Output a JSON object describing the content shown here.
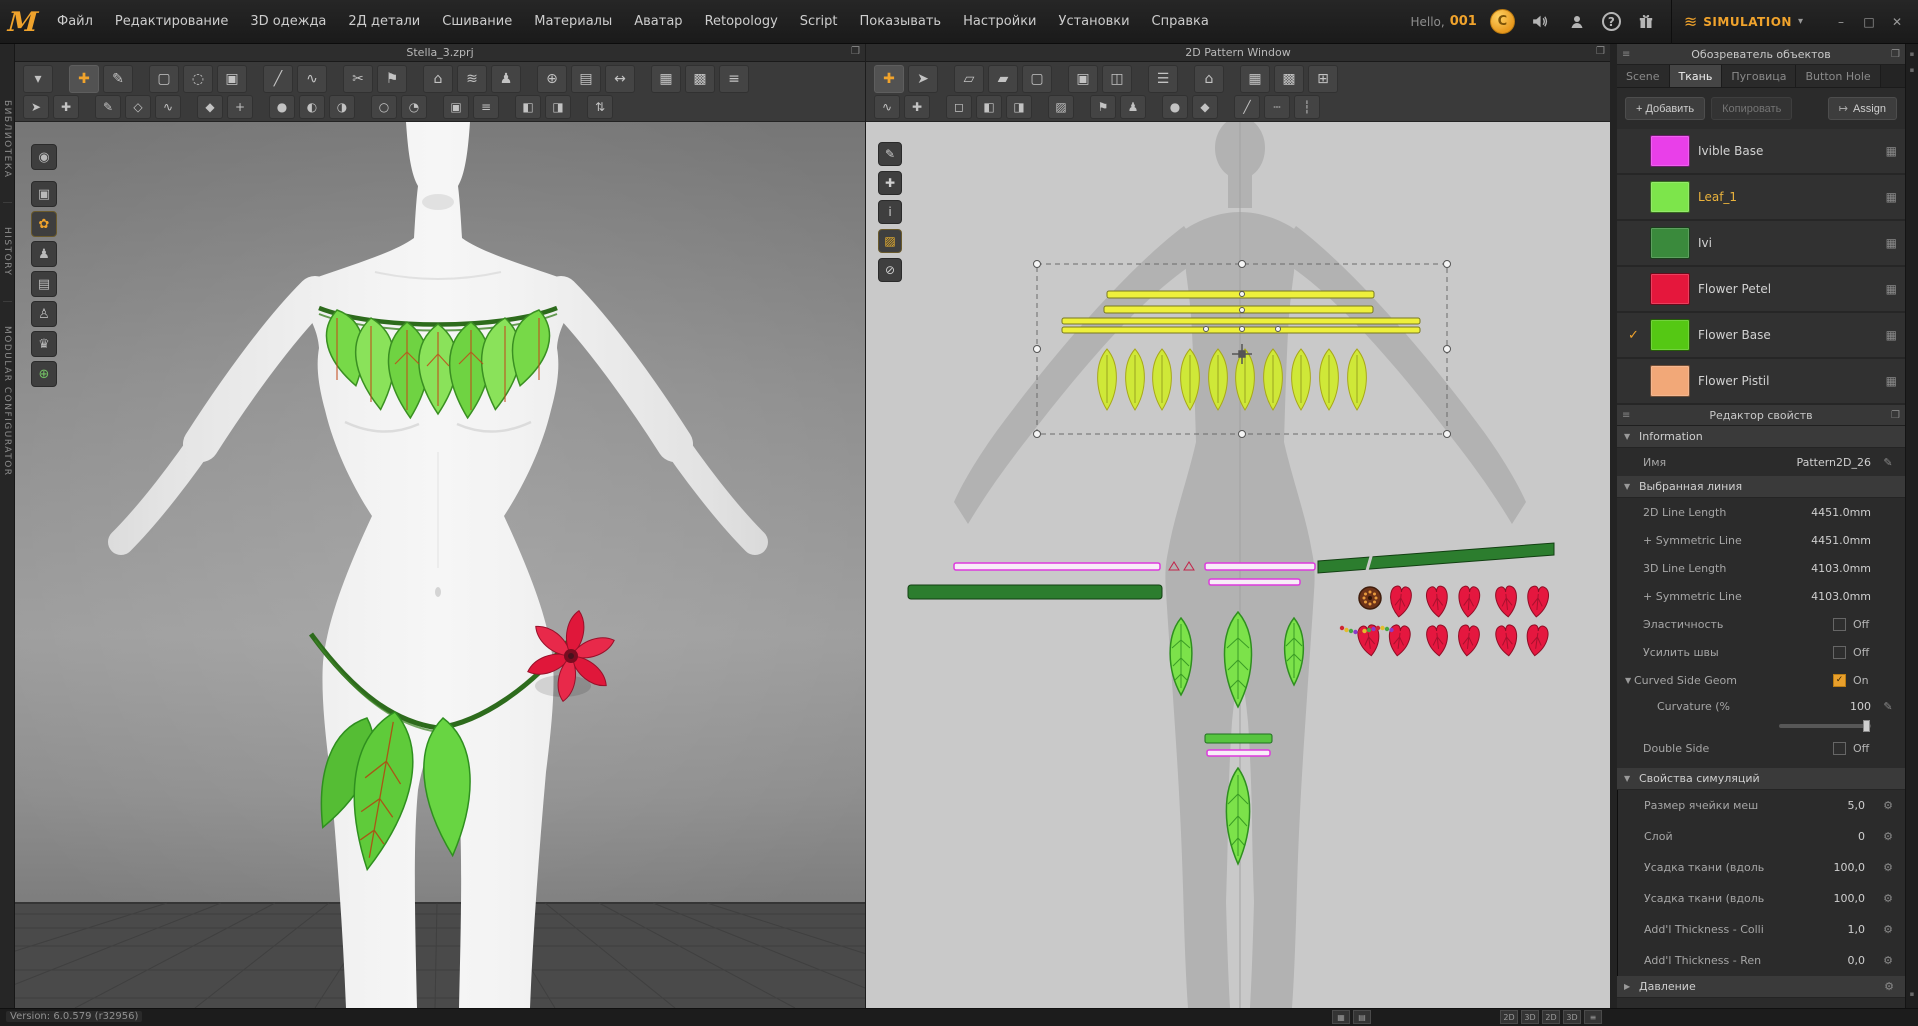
{
  "colors": {
    "accent": "#f0a32c",
    "leaf_green": "#7ce24a",
    "dark_vine_green": "#2d6b1c",
    "petal_red": "#e5173c",
    "magenta": "#e93fe9",
    "pistil_peach": "#f2a878",
    "selection_yellow": "#eef03c"
  },
  "menubar": {
    "logo": "M",
    "items": [
      "Файл",
      "Редактирование",
      "3D одежда",
      "2Д детали",
      "Сшивание",
      "Материалы",
      "Аватар",
      "Retopology",
      "Script",
      "Показывать",
      "Настройки",
      "Установки",
      "Справка"
    ],
    "greeting": "Hello,",
    "user": "001",
    "coin": "C",
    "help": "?",
    "simulation_icon": "≋",
    "simulation": "SIMULATION",
    "caret": "▾",
    "win_min": "–",
    "win_max": "□",
    "win_close": "✕"
  },
  "panels": {
    "p3d_tab": "Stella_3.zprj",
    "p2d_tab": "2D Pattern Window",
    "popup_icon": "❐",
    "side_tabs": [
      "БИБЛИОТЕКА",
      "HISTORY",
      "MODULAR CONFIGURATOR"
    ]
  },
  "toolbars": {
    "t3r1": [
      "▾",
      "✚",
      "✎",
      "▢",
      "◌",
      "▣",
      "╱",
      "∿",
      "✂",
      "⚑",
      "⌂",
      "≋",
      "♟",
      "⊕",
      "▤",
      "↔",
      "▦",
      "▩",
      "≡"
    ],
    "t3r2": [
      "➤",
      "✚",
      "✎",
      "◇",
      "∿",
      "◆",
      "+",
      "●",
      "◐",
      "◑",
      "○",
      "◔",
      "▣",
      "≡",
      "◧",
      "◨",
      "⇅"
    ],
    "t2r1": [
      "✚",
      "➤",
      "▱",
      "▰",
      "▢",
      "▣",
      "◫",
      "☰",
      "⌂",
      "▦",
      "▩",
      "⊞"
    ],
    "t2r2": [
      "∿",
      "✚",
      "◻",
      "◧",
      "◨",
      "▨",
      "⚑",
      "♟",
      "●",
      "◆",
      "╱",
      "┄",
      "┆"
    ],
    "lib": [
      "◉",
      "▣",
      "✿",
      "♟",
      "▤",
      "♙",
      "♛",
      "⊕"
    ],
    "strip2d": [
      "✎",
      "✚",
      "i",
      "▨",
      "⊘"
    ],
    "edge": [
      "▪",
      "▪",
      "▪"
    ]
  },
  "object_browser": {
    "title": "Обозреватель объектов",
    "menu_icon": "≡",
    "popup_icon": "❐",
    "tabs": [
      "Scene",
      "Ткань",
      "Пуговица",
      "Button Hole"
    ],
    "add_label": "+ Добавить",
    "copy_label": "Копировать",
    "assign_label": "Assign",
    "assign_icon": "↦",
    "row_icon": "▦",
    "fabrics": [
      {
        "name": "Ivible Base",
        "color": "#e93fe9"
      },
      {
        "name": "Leaf_1",
        "color": "#7de54b"
      },
      {
        "name": "Ivi",
        "color": "#3a8a3c"
      },
      {
        "name": "Flower Petel",
        "color": "#e5173c"
      },
      {
        "name": "Flower Base",
        "color": "#55c814",
        "check": "✓"
      },
      {
        "name": "Flower Pistil",
        "color": "#f2a878"
      }
    ]
  },
  "properties": {
    "title": "Редактор свойств",
    "menu_icon": "≡",
    "popup_icon": "❐",
    "tri_open": "▼",
    "tri_closed": "▶",
    "edit_icon": "✎",
    "wrench_icon": "⚙",
    "check_glyph": "✓",
    "sections": {
      "information": "Information",
      "selected_line": "Выбранная линия",
      "simulation": "Свойства симуляций",
      "pressure": "Давление"
    },
    "name_label": "Имя",
    "name_value": "Pattern2D_26",
    "line_rows": [
      {
        "label": "2D Line Length",
        "value": "4451.0mm"
      },
      {
        "label": "+ Symmetric Line",
        "value": "4451.0mm"
      },
      {
        "label": "3D Line Length",
        "value": "4103.0mm"
      },
      {
        "label": "+ Symmetric Line",
        "value": "4103.0mm"
      }
    ],
    "toggle_rows": [
      {
        "label": "Эластичность",
        "state": "Off"
      },
      {
        "label": "Усилить швы",
        "state": "Off"
      }
    ],
    "curved": {
      "label": "Curved Side Geom",
      "state": "On"
    },
    "curvature": {
      "label": "Curvature (%",
      "value": "100"
    },
    "double_side": {
      "label": "Double Side",
      "state": "Off"
    },
    "sim_rows": [
      {
        "label": "Размер ячейки меш",
        "value": "5,0"
      },
      {
        "label": "Слой",
        "value": "0"
      },
      {
        "label": "Усадка ткани (вдоль",
        "value": "100,0"
      },
      {
        "label": "Усадка ткани (вдоль",
        "value": "100,0"
      },
      {
        "label": "Add'l Thickness - Colli",
        "value": "1,0"
      },
      {
        "label": "Add'l Thickness - Ren",
        "value": "0,0"
      }
    ]
  },
  "statusbar": {
    "version": "Version: 6.0.579 (r32956)",
    "toggles_a": [
      "▦",
      "▤"
    ],
    "toggles_b": [
      "2D",
      "3D",
      "2D",
      "3D",
      "≡"
    ]
  }
}
